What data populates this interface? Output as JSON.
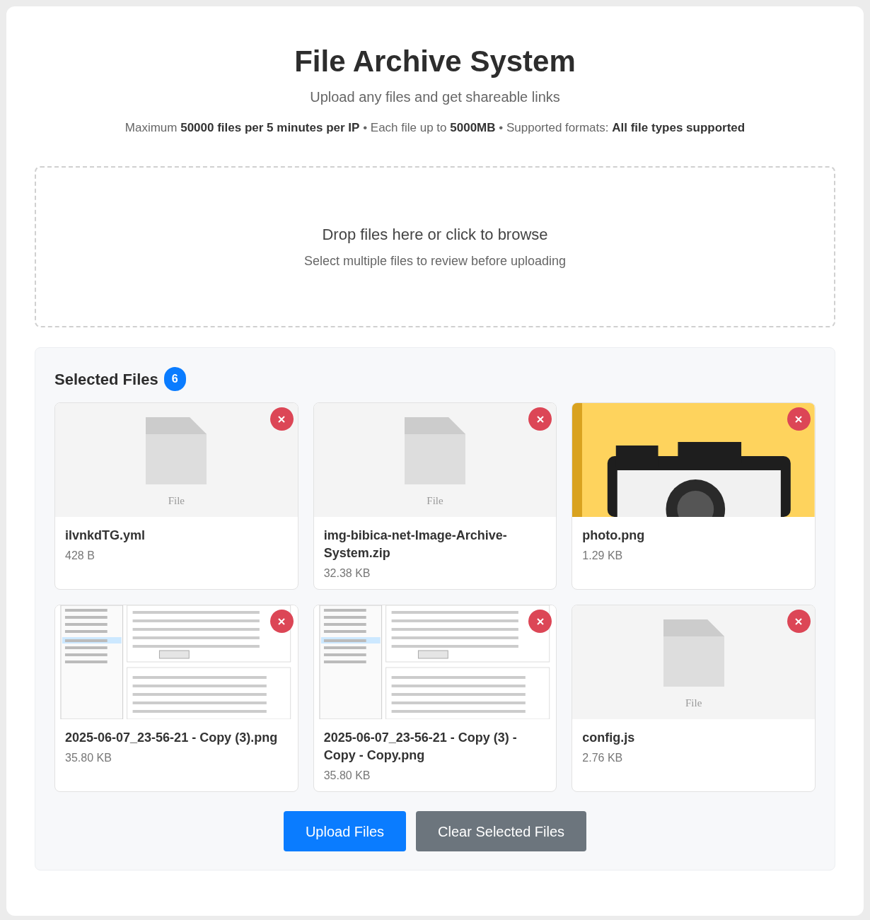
{
  "header": {
    "title": "File Archive System",
    "subtitle": "Upload any files and get shareable links",
    "limits": "Maximum **50000 files per 5 minutes per IP** • Each file up to **5000MB** • Supported formats: **All file types supported**"
  },
  "dropzone": {
    "title": "Drop files here or click to browse",
    "hint": "Select multiple files to review before uploading"
  },
  "selected": {
    "title": "Selected Files",
    "count": "6",
    "files": [
      {
        "name": "ilvnkdTG.yml",
        "size": "428 B",
        "preview": {
          "kind": "generic",
          "label": "File"
        }
      },
      {
        "name": "img-bibica-net-Image-Archive-System.zip",
        "size": "32.38 KB",
        "preview": {
          "kind": "generic",
          "label": "File"
        }
      },
      {
        "name": "photo.png",
        "size": "1.29 KB",
        "preview": {
          "kind": "photo"
        }
      },
      {
        "name": "2025-06-07_23-56-21 - Copy (3).png",
        "size": "35.80 KB",
        "preview": {
          "kind": "screenshot"
        }
      },
      {
        "name": "2025-06-07_23-56-21 - Copy (3) - Copy - Copy.png",
        "size": "35.80 KB",
        "preview": {
          "kind": "screenshot"
        }
      },
      {
        "name": "config.js",
        "size": "2.76 KB",
        "preview": {
          "kind": "generic",
          "label": "File"
        }
      }
    ]
  },
  "buttons": [
    {
      "label": "Upload Files",
      "kind": "primary"
    },
    {
      "label": "Clear Selected Files",
      "kind": "secondary"
    }
  ]
}
